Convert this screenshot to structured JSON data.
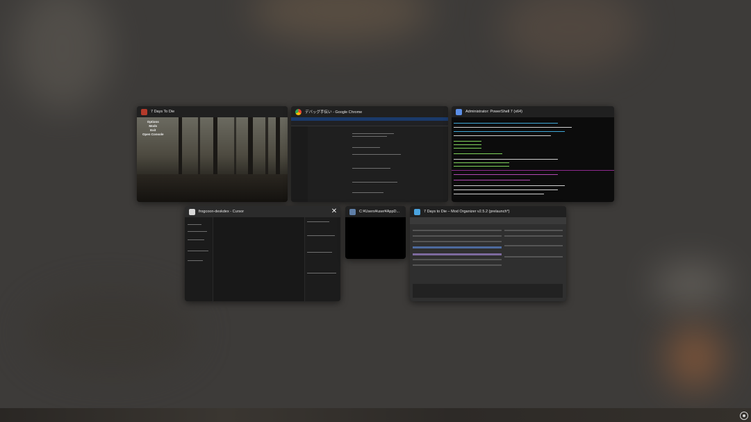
{
  "windows": [
    {
      "title": "7 Days To Die",
      "icon": "7dtd-game-icon",
      "color": "#b33a2a"
    },
    {
      "title": "デバッグ手伝い - Google Chrome",
      "icon": "chrome-icon",
      "color": "#4285f4"
    },
    {
      "title": "Administrator: PowerShell 7 (x64)",
      "icon": "powershell-icon",
      "color": "#5b8ee6"
    },
    {
      "title": "frogcoon-deskdex - Cursor",
      "icon": "cursor-icon",
      "color": "#d8d8d8",
      "close_label": "✕"
    },
    {
      "title": "C:¥Users¥user¥AppD...",
      "icon": "console-icon",
      "color": "#5f7fa8"
    },
    {
      "title": "7 Days to Die – Mod Organizer v2.5.2 (prelaunch*)",
      "icon": "mod-organizer-icon",
      "color": "#4aa3df"
    }
  ],
  "game_menu": [
    "Options",
    "Mods",
    "Exit",
    "Open Console"
  ]
}
